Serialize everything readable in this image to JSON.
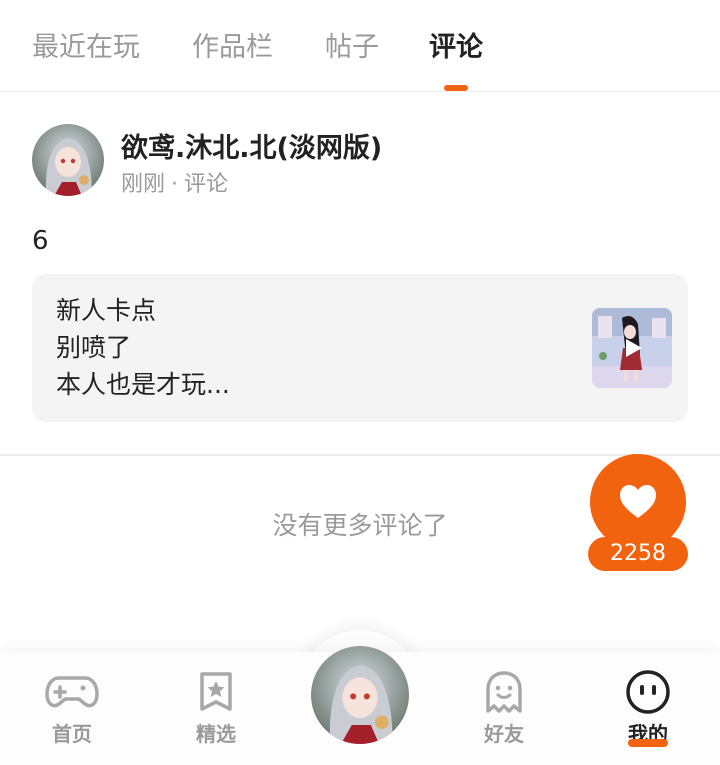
{
  "tabs": [
    {
      "label": "最近在玩"
    },
    {
      "label": "作品栏"
    },
    {
      "label": "帖子"
    },
    {
      "label": "评论",
      "active": true
    }
  ],
  "comment": {
    "author": "欲鸢.沐北.北(淡网版)",
    "time": "刚刚",
    "type": "评论",
    "text": "6",
    "quoted_post": {
      "lines": [
        "新人卡点",
        "别喷了",
        "本人也是才玩..."
      ]
    }
  },
  "footer_text": "没有更多评论了",
  "like": {
    "count": "2258",
    "icon": "heart-icon"
  },
  "bottom_nav": [
    {
      "label": "首页",
      "icon": "gamepad-icon"
    },
    {
      "label": "精选",
      "icon": "star-bookmark-icon"
    },
    {
      "label": "",
      "icon": "avatar"
    },
    {
      "label": "好友",
      "icon": "ghost-icon"
    },
    {
      "label": "我的",
      "icon": "smiley-face-icon",
      "active": true
    }
  ],
  "colors": {
    "accent": "#f2630f",
    "muted": "#9a9a9a",
    "text": "#222222"
  }
}
